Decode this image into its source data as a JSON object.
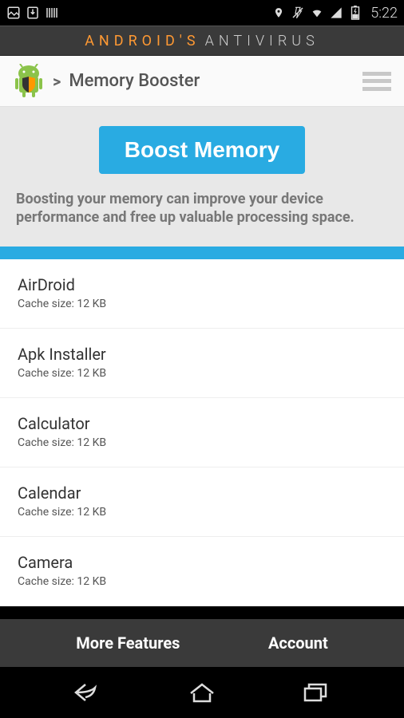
{
  "status": {
    "time": "5:22"
  },
  "brand": {
    "part1": "ANDROID'S",
    "part2": "ANTIVIRUS"
  },
  "header": {
    "separator": ">",
    "title": "Memory Booster"
  },
  "hero": {
    "button_label": "Boost Memory",
    "description": "Boosting your memory can improve your device performance and free up valuable processing space."
  },
  "apps": [
    {
      "name": "AirDroid",
      "cache": "Cache size: 12 KB"
    },
    {
      "name": "Apk Installer",
      "cache": "Cache size: 12 KB"
    },
    {
      "name": "Calculator",
      "cache": "Cache size: 12 KB"
    },
    {
      "name": "Calendar",
      "cache": "Cache size: 12 KB"
    },
    {
      "name": "Camera",
      "cache": "Cache size: 12 KB"
    }
  ],
  "tabs": {
    "more": "More Features",
    "account": "Account"
  }
}
